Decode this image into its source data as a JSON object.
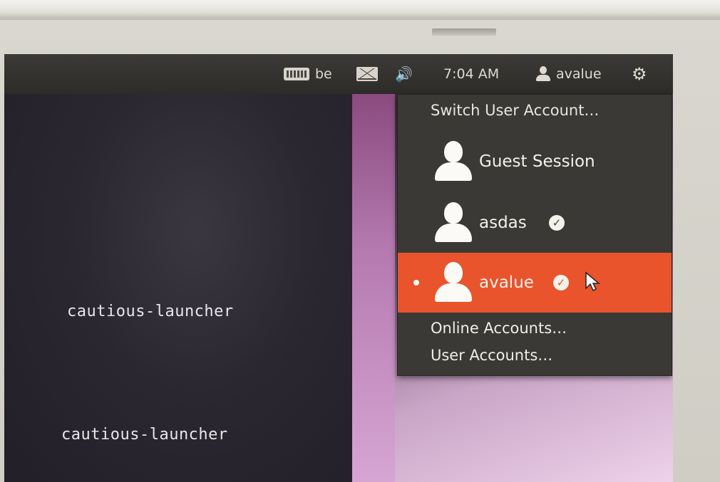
{
  "panel": {
    "keyboard_layout": "be",
    "clock": "7:04 AM",
    "user": "avalue",
    "icons": [
      "keyboard-icon",
      "mail-icon",
      "volume-icon",
      "user-icon",
      "gear-icon"
    ]
  },
  "desktop": {
    "terminal_1": "cautious-launcher",
    "terminal_2": "cautious-launcher"
  },
  "user_menu": {
    "header": "Switch User Account…",
    "users": [
      {
        "name": "Guest Session",
        "logged_in": false,
        "current": false
      },
      {
        "name": "asdas",
        "logged_in": true,
        "current": false
      },
      {
        "name": "avalue",
        "logged_in": true,
        "current": true
      }
    ],
    "online_accounts": "Online Accounts…",
    "user_accounts": "User Accounts…",
    "accent_color": "#e9542c"
  }
}
